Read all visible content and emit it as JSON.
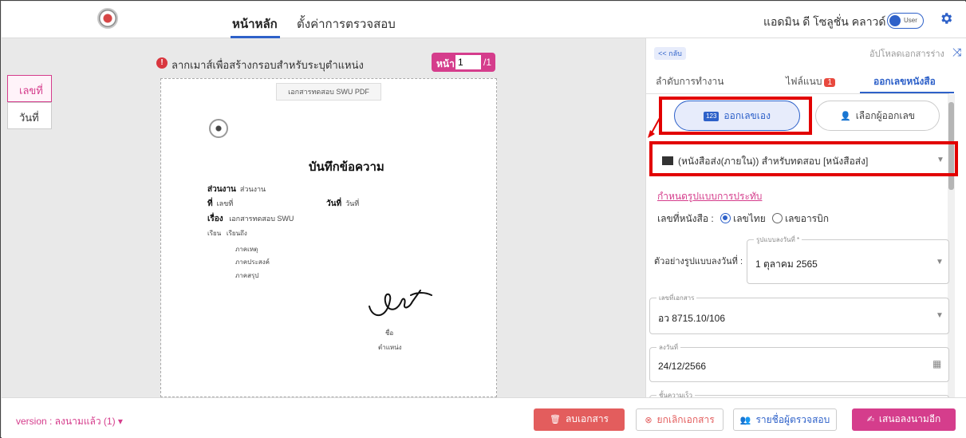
{
  "topbar": {
    "tabs": [
      {
        "label": "หน้าหลัก",
        "active": true
      },
      {
        "label": "ตั้งค่าการตรวจสอบ",
        "active": false
      }
    ],
    "user_name": "แอดมิน ดี โซลูชั่น คลาวด์",
    "toggle_label": "User"
  },
  "sidebar": {
    "tabs": [
      {
        "label": "เลขที่",
        "selected": true
      },
      {
        "label": "วันที่",
        "selected": false
      }
    ]
  },
  "document": {
    "drag_hint": "ลากเมาส์เพื่อสร้างกรอบสำหรับระบุตำแหน่ง",
    "pager": {
      "label": "หน้า :",
      "current": "1",
      "total": "/1"
    },
    "file_tag": "เอกสารทดสอบ SWU  PDF",
    "title": "บันทึกข้อความ",
    "dept_label": "ส่วนงาน",
    "dept_value": "ส่วนงาน",
    "no_label": "ที่",
    "no_value": "เลขที่",
    "date_label": "วันที่",
    "date_value": "วันที่",
    "subject_label": "เรื่อง",
    "subject_value": "เอกสารทดสอบ SWU",
    "to_label": "เรียน",
    "to_value": "เรียนถึง",
    "body_lines": [
      "ภาคเหตุ",
      "ภาคประสงค์",
      "ภาคสรุป"
    ],
    "sign_name": "ชื่อ",
    "sign_position": "ตำแหน่ง"
  },
  "panel": {
    "back": "<< กลับ",
    "upload_draft": "อัปโหลดเอกสารร่าง",
    "tabs": [
      {
        "label": "ลำดับการทำงาน",
        "badge": null,
        "active": false
      },
      {
        "label": "ไฟล์แนบ",
        "badge": "1",
        "active": false
      },
      {
        "label": "ออกเลขหนังสือ",
        "badge": null,
        "active": true
      }
    ],
    "mode_self": "ออกเลขเอง",
    "mode_self_icon": "123",
    "mode_choose": "เลือกผู้ออกเลข",
    "book_type": "(หนังสือส่ง(ภายใน)) สำหรับทดสอบ [หนังสือส่ง]",
    "format_link": "กำหนดรูปแบบการประทับ",
    "number_label": "เลขที่หนังสือ :",
    "number_options": [
      {
        "label": "เลขไทย",
        "selected": true
      },
      {
        "label": "เลขอารบิก",
        "selected": false
      }
    ],
    "date_example_label": "ตัวอย่างรูปแบบลงวันที่ :",
    "date_format_legend": "รูปแบบลงวันที่ *",
    "date_format_value": "1 ตุลาคม 2565",
    "doc_no_legend": "เลขที่เอกสาร",
    "doc_no_value": "อว 8715.10/106",
    "sign_date_legend": "ลงวันที่",
    "sign_date_value": "24/12/2566",
    "speed_legend": "ชั้นความเร็ว"
  },
  "bottombar": {
    "version": "version : ลงนามแล้ว (1)",
    "delete": "ลบเอกสาร",
    "cancel": "ยกเลิกเอกสาร",
    "reviewers": "รายชื่อผู้ตรวจสอบ",
    "submit": "เสนอลงนามอีก"
  },
  "colors": {
    "accent": "#2e61c9",
    "brand_pink": "#d53d8c",
    "danger": "#e35d5d",
    "highlight": "#e20000"
  }
}
